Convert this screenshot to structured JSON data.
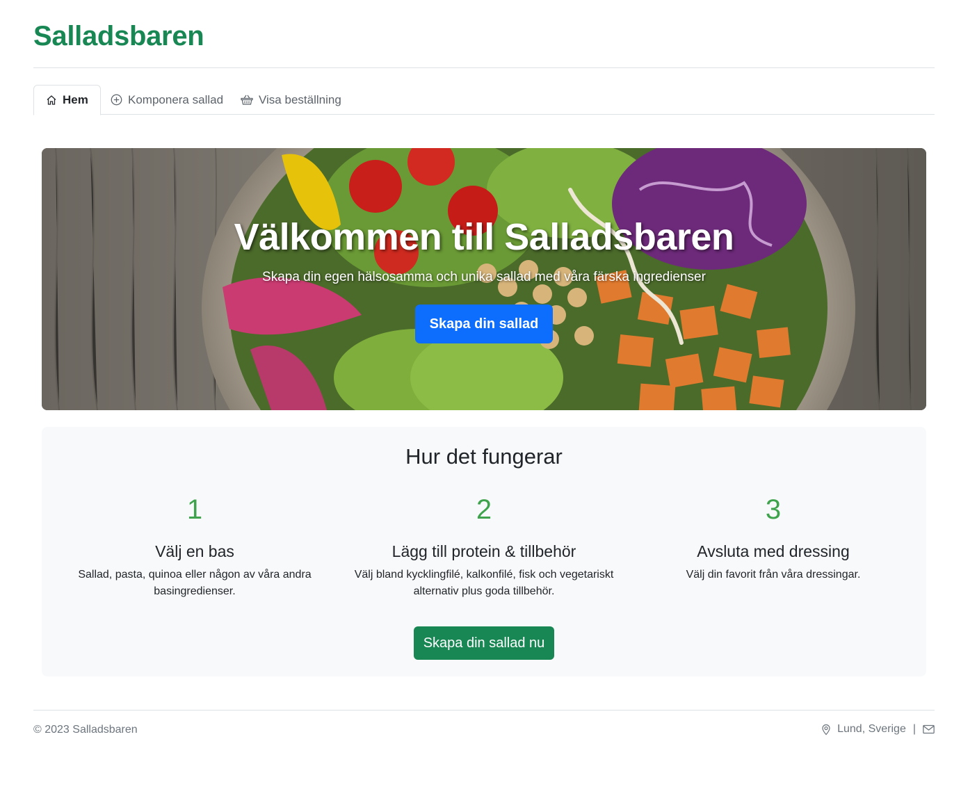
{
  "brand": {
    "title": "Salladsbaren",
    "color": "#198754"
  },
  "tabs": [
    {
      "label": "Hem",
      "icon": "house-icon",
      "active": true
    },
    {
      "label": "Komponera sallad",
      "icon": "plus-circle-icon",
      "active": false
    },
    {
      "label": "Visa beställning",
      "icon": "basket-icon",
      "active": false
    }
  ],
  "hero": {
    "title": "Välkommen till Salladsbaren",
    "subtitle": "Skapa din egen hälsosamma och unika sallad med våra färska ingredienser",
    "button_label": "Skapa din sallad",
    "button_color": "#0d6efd"
  },
  "how": {
    "title": "Hur det fungerar",
    "steps": [
      {
        "number": "1",
        "title": "Välj en bas",
        "text": "Sallad, pasta, quinoa eller någon av våra andra basingredienser."
      },
      {
        "number": "2",
        "title": "Lägg till protein & tillbehör",
        "text": "Välj bland kycklingfilé, kalkonfilé, fisk och vegetariskt alternativ plus goda tillbehör."
      },
      {
        "number": "3",
        "title": "Avsluta med dressing",
        "text": "Välj din favorit från våra dressingar."
      }
    ],
    "button_label": "Skapa din sallad nu",
    "button_color": "#198754"
  },
  "footer": {
    "copyright": "© 2023 Salladsbaren",
    "location": "Lund, Sverige",
    "separator": "|",
    "location_icon": "map-pin-icon",
    "mail_icon": "envelope-icon"
  }
}
